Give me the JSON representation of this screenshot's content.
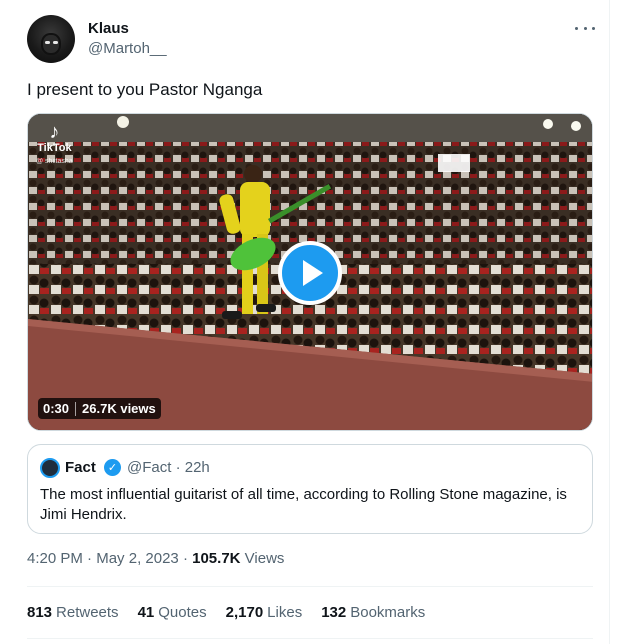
{
  "author": {
    "name": "Klaus",
    "handle": "@Martoh__"
  },
  "tweet": {
    "text": "I present to you Pastor Nganga"
  },
  "media": {
    "watermark": "TikTok",
    "watermark_user": "@ shiitasha",
    "duration": "0:30",
    "views": "26.7K views"
  },
  "quoted": {
    "name": "Fact",
    "handle": "@Fact",
    "time": "22h",
    "text": "The most influential guitarist of all time, according to Rolling Stone magazine, is Jimi Hendrix."
  },
  "meta": {
    "time": "4:20 PM",
    "date": "May 2, 2023",
    "views_count": "105.7K",
    "views_label": "Views"
  },
  "stats": {
    "retweets_count": "813",
    "retweets_label": "Retweets",
    "quotes_count": "41",
    "quotes_label": "Quotes",
    "likes_count": "2,170",
    "likes_label": "Likes",
    "bookmarks_count": "132",
    "bookmarks_label": "Bookmarks"
  },
  "colors": {
    "accent": "#1d9bf0",
    "secondary_text": "#536471",
    "primary_text": "#0f1419"
  }
}
